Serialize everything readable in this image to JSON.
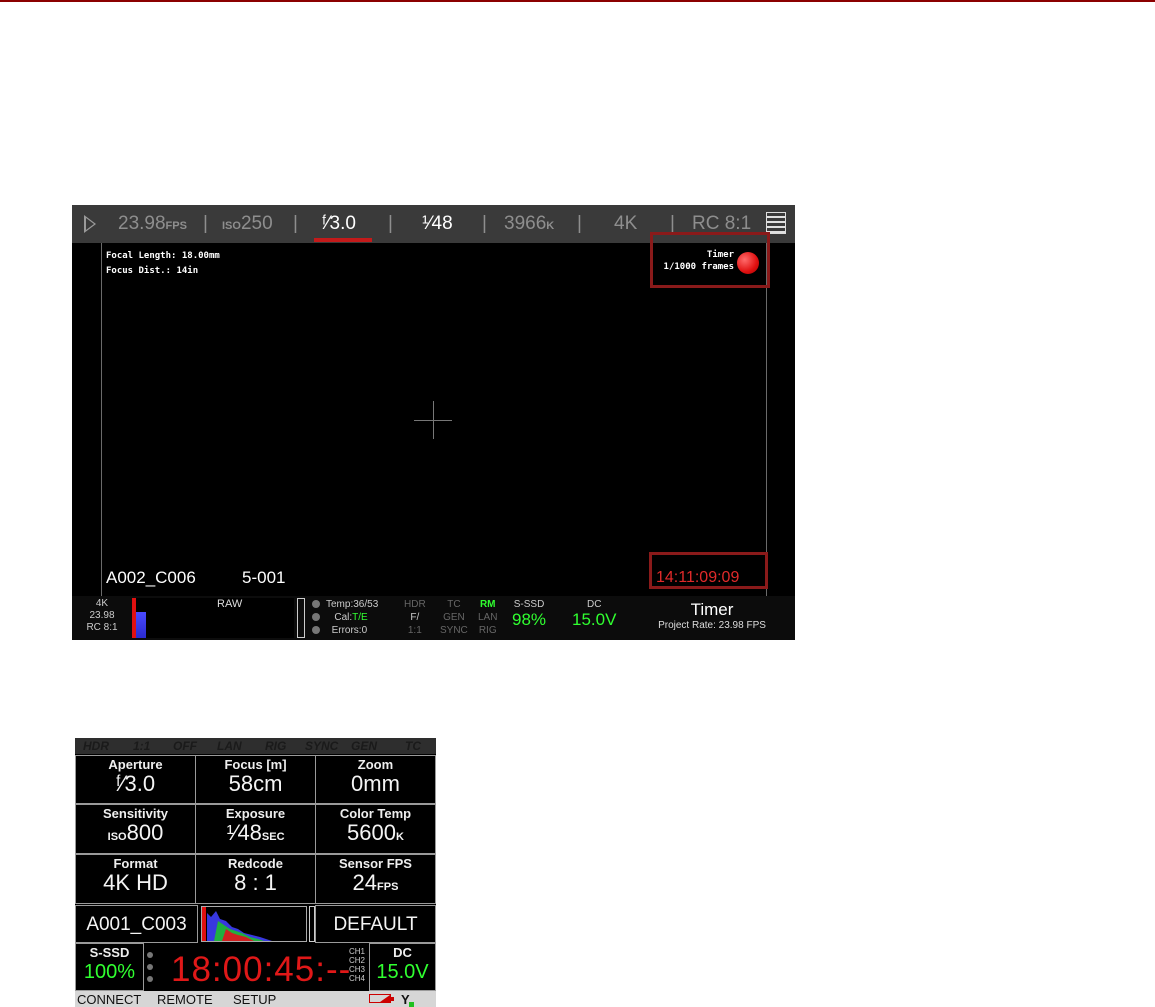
{
  "monitor": {
    "topbar": {
      "fps_value": "23.98",
      "fps_unit": "FPS",
      "iso_prefix": "ISO",
      "iso_value": "250",
      "aperture": "ᶠ⁄3.0",
      "shutter": "¹⁄48",
      "resolution_value": "3966",
      "resolution_unit": "K",
      "format": "4K",
      "redcode": "RC 8:1"
    },
    "lens_info": {
      "focal_length": "Focal Length: 18.00mm",
      "focus_dist": "Focus Dist.: 14in"
    },
    "timer": {
      "label": "Timer",
      "frames": "1/1000 frames"
    },
    "clip": {
      "name": "A002_C006",
      "take": "5-001",
      "timecode": "14:11:09:09"
    },
    "bottombar": {
      "format_lines": [
        "4K",
        "23.98",
        "RC 8:1"
      ],
      "raw_label": "RAW",
      "temp": "Temp:36/53",
      "cal_label": "Cal:",
      "cal_value": "T/E",
      "errors": "Errors:0",
      "grid": [
        [
          "HDR",
          "F/",
          "1:1"
        ],
        [
          "TC",
          "GEN",
          "SYNC"
        ],
        [
          "RM",
          "LAN",
          "RIG"
        ]
      ],
      "media_label": "S-SSD",
      "media_value": "98%",
      "power_label": "DC",
      "power_value": "15.0V",
      "mode_title": "Timer",
      "project_rate": "Project Rate: 23.98 FPS"
    },
    "colors": {
      "accent_red": "#c31a1a",
      "status_green": "#30ff30",
      "timecode_red": "#e02a2a"
    }
  },
  "lcd": {
    "top": [
      "HDR",
      "1:1",
      "OFF",
      "LAN",
      "RIG",
      "SYNC",
      "GEN",
      "TC"
    ],
    "cells": {
      "aperture": {
        "label": "Aperture",
        "value": "ᶠ⁄3.0"
      },
      "focus": {
        "label": "Focus [m]",
        "value": "58cm"
      },
      "zoom": {
        "label": "Zoom",
        "value": "0mm"
      },
      "sensitivity": {
        "label": "Sensitivity",
        "prefix": "ISO",
        "value": "800"
      },
      "exposure": {
        "label": "Exposure",
        "value": "¹⁄48",
        "suffix": "SEC"
      },
      "color_temp": {
        "label": "Color Temp",
        "value": "5600",
        "suffix": "K"
      },
      "format": {
        "label": "Format",
        "value": "4K HD"
      },
      "redcode": {
        "label": "Redcode",
        "value": "8 : 1"
      },
      "sensor_fps": {
        "label": "Sensor FPS",
        "value": "24",
        "suffix": "FPS"
      },
      "clip": {
        "value": "A001_C003"
      },
      "look": {
        "value": "DEFAULT"
      },
      "media": {
        "label": "S-SSD",
        "value": "100%"
      },
      "power": {
        "label": "DC",
        "value": "15.0V"
      }
    },
    "timecode": "18:00:45:--",
    "channels": [
      "CH1",
      "CH2",
      "CH3",
      "CH4"
    ],
    "bottom": {
      "connect": "CONNECT",
      "remote": "REMOTE",
      "setup": "SETUP"
    }
  }
}
